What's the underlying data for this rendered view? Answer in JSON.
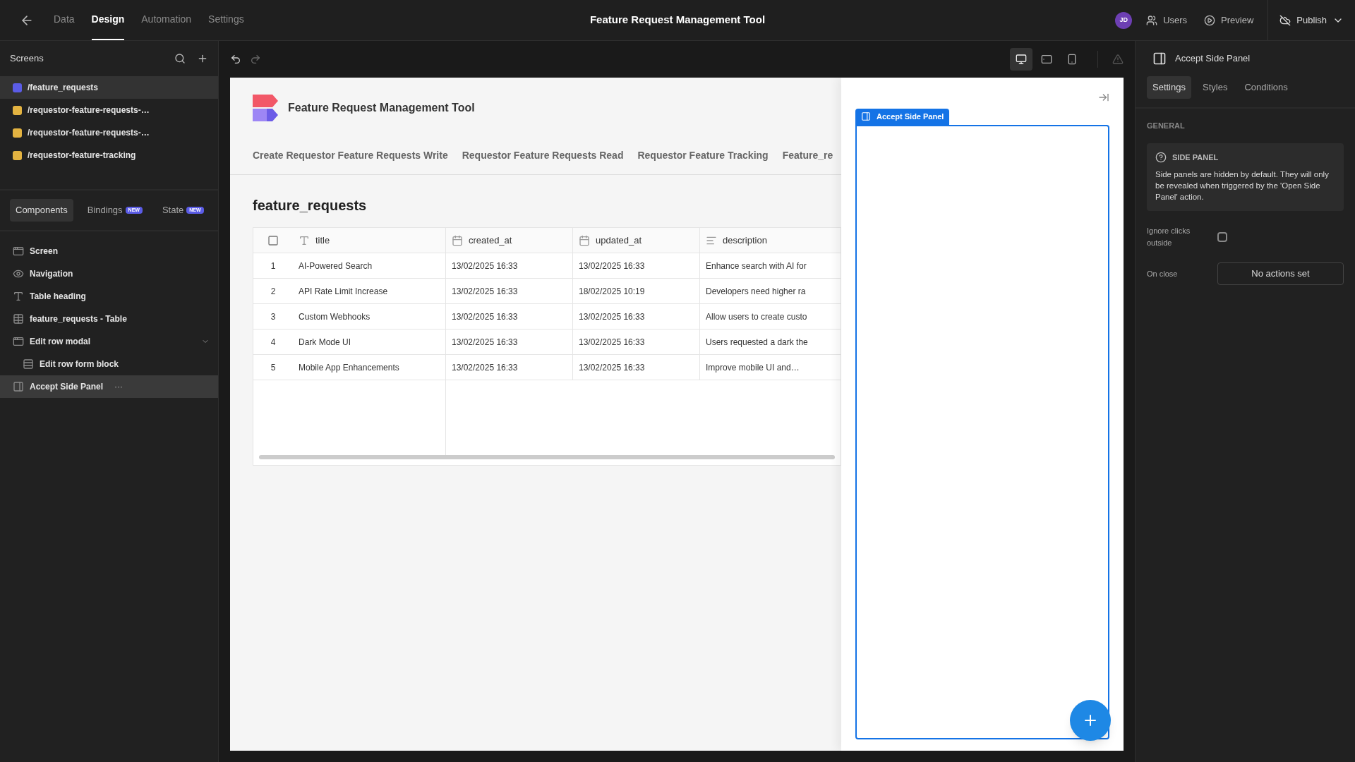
{
  "topbar": {
    "tabs": [
      {
        "label": "Data",
        "selected": false
      },
      {
        "label": "Design",
        "selected": true
      },
      {
        "label": "Automation",
        "selected": false
      },
      {
        "label": "Settings",
        "selected": false
      }
    ],
    "title": "Feature Request Management Tool",
    "avatar": "JD",
    "users": "Users",
    "preview": "Preview",
    "publish": "Publish"
  },
  "sidebar": {
    "screens_title": "Screens",
    "screens": [
      {
        "path": "/feature_requests",
        "color": "#5b5ce6",
        "selected": true
      },
      {
        "path": "/requestor-feature-requests-…",
        "color": "#e3b341",
        "selected": false
      },
      {
        "path": "/requestor-feature-requests-…",
        "color": "#e3b341",
        "selected": false
      },
      {
        "path": "/requestor-feature-tracking",
        "color": "#e3b341",
        "selected": false
      }
    ],
    "panel_tabs": [
      {
        "label": "Components",
        "selected": true
      },
      {
        "label": "Bindings",
        "badge": "NEW",
        "selected": false
      },
      {
        "label": "State",
        "badge": "NEW",
        "selected": false
      }
    ],
    "tree": [
      {
        "label": "Screen",
        "kind": "screen",
        "selected": false
      },
      {
        "label": "Navigation",
        "kind": "navigation",
        "selected": false
      },
      {
        "label": "Table heading",
        "kind": "text",
        "selected": false
      },
      {
        "label": "feature_requests - Table",
        "kind": "table",
        "selected": false
      },
      {
        "label": "Edit row modal",
        "kind": "modal",
        "selected": false,
        "expanded": true,
        "children": [
          {
            "label": "Edit row form block",
            "kind": "form",
            "selected": false
          }
        ]
      },
      {
        "label": "Accept Side Panel",
        "kind": "side_panel",
        "selected": true,
        "menu": "···"
      }
    ]
  },
  "canvas": {
    "devices": [
      {
        "kind": "desktop",
        "selected": true
      },
      {
        "kind": "tablet",
        "selected": false
      },
      {
        "kind": "mobile",
        "selected": false
      }
    ],
    "app_title": "Feature Request Management Tool",
    "nav_links": [
      "Create Requestor Feature Requests Write",
      "Requestor Feature Requests Read",
      "Requestor Feature Tracking",
      "Feature_re"
    ],
    "heading": "feature_requests",
    "table": {
      "select_all": {
        "checked": false
      },
      "columns": [
        {
          "label": "title",
          "kind": "text"
        },
        {
          "label": "created_at",
          "kind": "date"
        },
        {
          "label": "updated_at",
          "kind": "date"
        },
        {
          "label": "description",
          "kind": "longform"
        }
      ],
      "rows": [
        {
          "number": "1",
          "cells": [
            "AI-Powered Search",
            "13/02/2025 16:33",
            "13/02/2025 16:33",
            "Enhance search with AI for"
          ]
        },
        {
          "number": "2",
          "cells": [
            "API Rate Limit Increase",
            "13/02/2025 16:33",
            "18/02/2025 10:19",
            "Developers need higher ra"
          ]
        },
        {
          "number": "3",
          "cells": [
            "Custom Webhooks",
            "13/02/2025 16:33",
            "13/02/2025 16:33",
            "Allow users to create custo"
          ]
        },
        {
          "number": "4",
          "cells": [
            "Dark Mode UI",
            "13/02/2025 16:33",
            "13/02/2025 16:33",
            "Users requested a dark the"
          ]
        },
        {
          "number": "5",
          "cells": [
            "Mobile App Enhancements",
            "13/02/2025 16:33",
            "13/02/2025 16:33",
            "Improve mobile UI and…"
          ]
        }
      ]
    },
    "side_panel": {
      "label": "Accept Side Panel"
    }
  },
  "inspector": {
    "title": "Accept Side Panel",
    "tabs": [
      {
        "label": "Settings",
        "selected": true
      },
      {
        "label": "Styles",
        "selected": false
      },
      {
        "label": "Conditions",
        "selected": false
      }
    ],
    "section": "GENERAL",
    "info": {
      "title": "SIDE PANEL",
      "text": "Side panels are hidden by default. They will only be revealed when triggered by the 'Open Side Panel' action."
    },
    "ignore_clicks": {
      "label": "Ignore clicks outside",
      "checked": false
    },
    "on_close": {
      "label": "On close",
      "button": "No actions set"
    }
  }
}
